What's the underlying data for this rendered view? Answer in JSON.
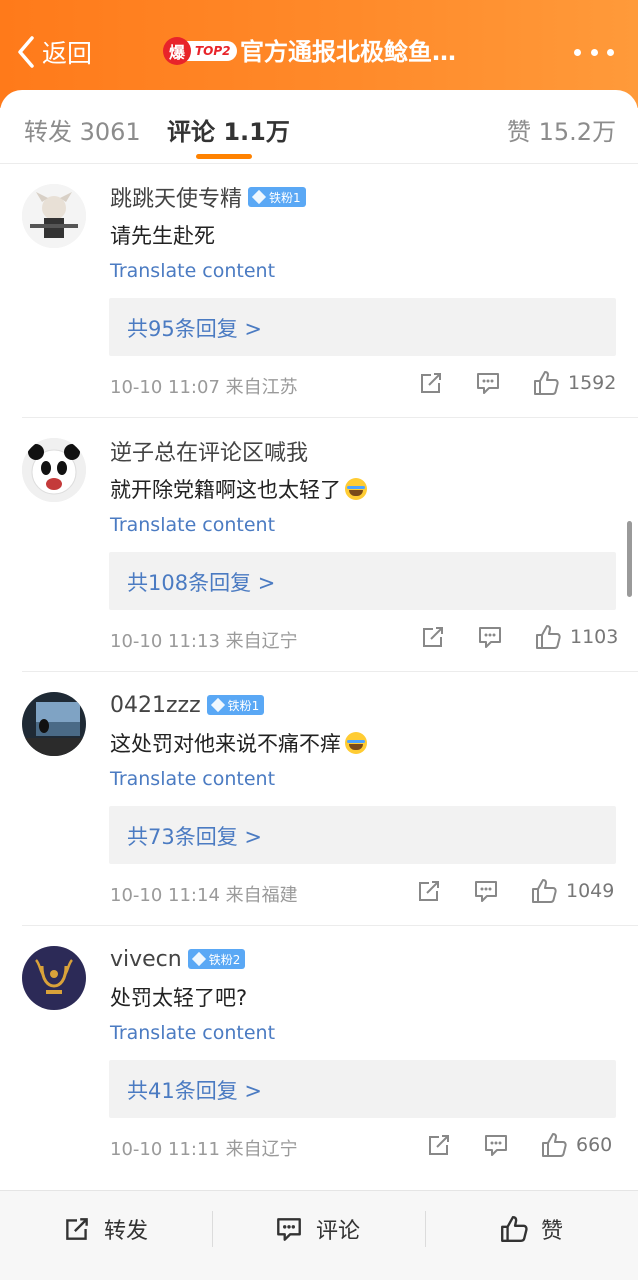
{
  "header": {
    "back_label": "返回",
    "hot_badge_char": "爆",
    "hot_rank": "TOP2",
    "title": "官方通报北极鲶鱼…"
  },
  "tabs": [
    {
      "label": "转发 3061"
    },
    {
      "label": "评论 1.1万"
    },
    {
      "label": "赞 15.2万"
    }
  ],
  "comments": [
    {
      "username": "跳跳天使专精",
      "badge": "铁粉1",
      "text": "请先生赴死",
      "has_emoji": false,
      "translate": "Translate content",
      "replies": "共95条回复 >",
      "meta": "10-10 11:07  来自江苏",
      "likes": "1592"
    },
    {
      "username": "逆子总在评论区喊我",
      "badge": "",
      "text": "就开除党籍啊这也太轻了",
      "has_emoji": true,
      "translate": "Translate content",
      "replies": "共108条回复 >",
      "meta": "10-10 11:13  来自辽宁",
      "likes": "1103"
    },
    {
      "username": "0421zzz",
      "badge": "铁粉1",
      "text": "这处罚对他来说不痛不痒",
      "has_emoji": true,
      "translate": "Translate content",
      "replies": "共73条回复 >",
      "meta": "10-10 11:14  来自福建",
      "likes": "1049"
    },
    {
      "username": "vivecn",
      "badge": "铁粉2",
      "text": "处罚太轻了吧?",
      "has_emoji": false,
      "translate": "Translate content",
      "replies": "共41条回复 >",
      "meta": "10-10 11:11  来自辽宁",
      "likes": "660"
    }
  ],
  "bottom_bar": {
    "repost_label": "转发",
    "comment_label": "评论",
    "like_label": "赞"
  },
  "colors": {
    "header_orange": "#ff8a2a",
    "accent": "#ff8200",
    "link_blue": "#4b7bc2",
    "badge_blue": "#5aa8f5"
  }
}
